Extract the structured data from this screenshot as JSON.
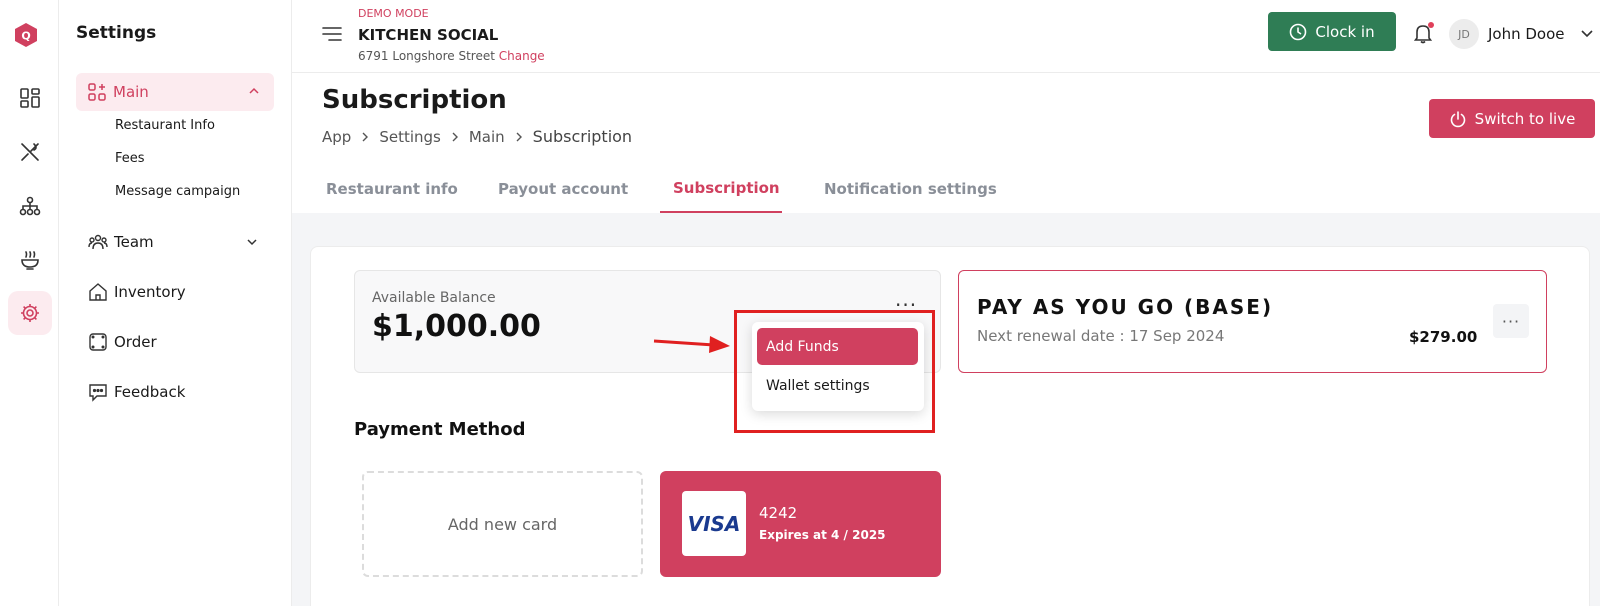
{
  "rail": {
    "logo_letter": "Q",
    "items": [
      "dashboard-icon",
      "utensils-icon",
      "hierarchy-icon",
      "food-bowl-icon",
      "gear-icon"
    ],
    "active": "gear-icon"
  },
  "sidebar": {
    "title": "Settings",
    "main": {
      "label": "Main",
      "subitems": [
        "Restaurant Info",
        "Fees",
        "Message campaign"
      ]
    },
    "items": [
      {
        "label": "Team",
        "icon": "team-icon"
      },
      {
        "label": "Inventory",
        "icon": "home-icon"
      },
      {
        "label": "Order",
        "icon": "order-icon"
      },
      {
        "label": "Feedback",
        "icon": "feedback-icon"
      }
    ]
  },
  "header": {
    "demo_label": "DEMO MODE",
    "venue_name": "KITCHEN SOCIAL",
    "address": "6791 Longshore Street",
    "change_label": "Change",
    "clock_in_label": "Clock in",
    "user_initials": "JD",
    "user_name": "John Dooe"
  },
  "page": {
    "title": "Subscription",
    "breadcrumbs": [
      "App",
      "Settings",
      "Main",
      "Subscription"
    ],
    "switch_label": "Switch to live",
    "tabs": [
      "Restaurant info",
      "Payout account",
      "Subscription",
      "Notification settings"
    ],
    "active_tab": "Subscription"
  },
  "balance": {
    "label": "Available Balance",
    "amount": "$1,000.00",
    "menu_dots": "···"
  },
  "dropdown": {
    "items": [
      "Add Funds",
      "Wallet settings"
    ]
  },
  "plan": {
    "name": "PAY AS YOU GO (BASE)",
    "renewal": "Next renewal date : 17 Sep 2024",
    "price": "$279.00",
    "menu_dots": "···"
  },
  "payment": {
    "title": "Payment Method",
    "add_card_label": "Add new card",
    "card": {
      "brand": "VISA",
      "last4": "4242",
      "expiry": "Expires at 4 / 2025"
    }
  },
  "colors": {
    "accent": "#d0405f",
    "clock_green": "#2f7d55",
    "annotation_red": "#e02020"
  }
}
